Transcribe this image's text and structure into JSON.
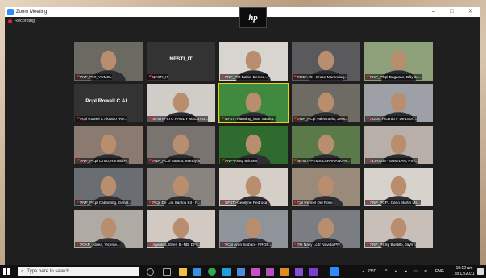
{
  "window": {
    "title": "Zoom Meeting",
    "minimize": "–",
    "maximize": "□",
    "close": "✕"
  },
  "recording": {
    "label": "Recording"
  },
  "brand": {
    "logo": "hp"
  },
  "participants": [
    {
      "label": "PNP_PLT_YUMOL",
      "center": ""
    },
    {
      "label": "NFSTI_IT",
      "center": "NFSTI_IT"
    },
    {
      "label": "PNP_Pat Baltic, Denise...",
      "center": ""
    },
    {
      "label": "PDEA IO I Grace Maranduq...",
      "center": ""
    },
    {
      "label": "PNP_PCpl Bagasan, Billy Jo...",
      "center": ""
    },
    {
      "label": "Pcpl Rowell C Alojado -Re...",
      "center": "Pcpl Rowell C Al..."
    },
    {
      "label": "NFSTI-FLTC RANDY MALUYO...",
      "center": ""
    },
    {
      "label": "NFSTI Flansing_Man Satuito...",
      "center": ""
    },
    {
      "label": "PNP_PCpl Valenzuela, Jess...",
      "center": ""
    },
    {
      "label": "PDDG Ricardo F De Leon...",
      "center": ""
    },
    {
      "label": "PNP_PCpl Cinco, Ronald P...",
      "center": ""
    },
    {
      "label": "PNP_PCpl Santos, Mandy S",
      "center": ""
    },
    {
      "label": "PNP-PSSg Briones",
      "center": ""
    },
    {
      "label": "NFSTI -PEMS LARANANG-R...",
      "center": ""
    },
    {
      "label": "FLT-0038 - SUMILAN, PST...",
      "center": ""
    },
    {
      "label": "PNP_PCpl Cabanting, Genal...",
      "center": ""
    },
    {
      "label": "PCpl De Los Santos Kit - P...",
      "center": ""
    },
    {
      "label": "NFSTI-Genilyne Pedrosa",
      "center": ""
    },
    {
      "label": "Cpl Rennel Del Poso",
      "center": ""
    },
    {
      "label": "PNP_PCPL Carlo Martin Ma...",
      "center": ""
    },
    {
      "label": "PCAP_Abrea, Vicente...",
      "center": ""
    },
    {
      "label": "Agontad, Efren B.-NBI DFI...",
      "center": ""
    },
    {
      "label": "PCpl Aren Siriban - PROB...",
      "center": ""
    },
    {
      "label": "PH Navy Lcdr Navida PN",
      "center": ""
    },
    {
      "label": "PNP_PSSg Bustillo, Jayh...",
      "center": ""
    }
  ],
  "taskbar": {
    "search_placeholder": "Type here to search",
    "weather": "23°C",
    "language": "ENG",
    "time": "10:12 am",
    "date": "28/12/2021"
  },
  "colors": {
    "accent": "#2d8cff",
    "speaker_outline": "#e8d800",
    "muted": "#e22233"
  }
}
